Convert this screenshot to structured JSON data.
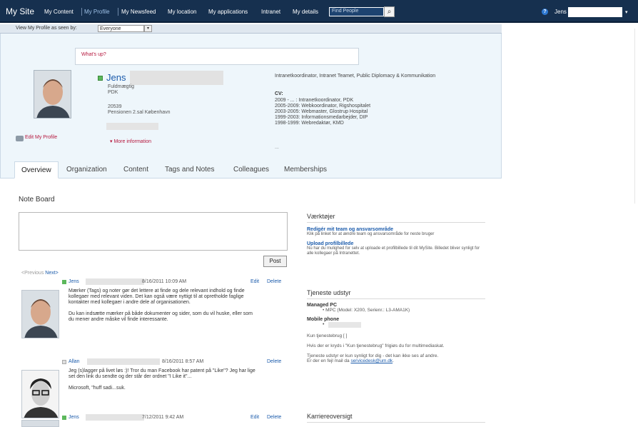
{
  "topbar": {
    "site_title": "My Site",
    "nav": [
      "My Content",
      "My Profile",
      "My Newsfeed",
      "My location",
      "My applications",
      "Intranet",
      "My details"
    ],
    "search_placeholder": "Find People",
    "user": "Jens"
  },
  "viewas": {
    "label": "View My Profile as seen by:",
    "value": "Everyone"
  },
  "profile": {
    "status_prompt": "What's up?",
    "name": "Jens",
    "edit_label": "Edit My Profile",
    "info": [
      "Fuldmægtig",
      "PDK",
      "",
      "20539",
      "Pensionen 2.sal København"
    ],
    "more_info": "▾ More information",
    "about": "Intranetkoordinator, Intranet Teamet, Public Diplomacy & Kommunikation",
    "cv_title": "CV:",
    "cv": [
      "2009 - ... : Intranetkoordinator, PDK",
      "2005-2009: Webkoordinator, Rigshospitalet",
      "2003-2005: Webmaster, Glostrup Hospital",
      "1999-2003: Informationsmedarbejder, DIP",
      "1998-1999: Webredaktør, KMD"
    ],
    "cv_more": "..."
  },
  "tabs": [
    "Overview",
    "Organization",
    "Content",
    "Tags and Notes",
    "Colleagues",
    "Memberships"
  ],
  "noteboard": {
    "title": "Note Board",
    "post": "Post",
    "prev": "<Previous",
    "next": "Next>",
    "notes": [
      {
        "author": "Jens",
        "date": "8/16/2011 10:09 AM",
        "edit": "Edit",
        "delete": "Delete",
        "p1": "Mærker (Tags) og noter gør det lettere at finde og dele relevant indhold og finde kollegaer med relevant viden. Det kan også være nyttigt til at opretholde faglige kontakter med kollegaer i andre dele af organisationen.",
        "p2": "Du kan indsætte mærker på både dokumenter og sider, som du vil huske, eller som du mener andre måske vil finde interessante."
      },
      {
        "author": "Allan",
        "date": "8/16/2011 8:57 AM",
        "delete": "Delete",
        "p1": "Jeg (s)lagger på livet løs :)! Tror du man Facebook har patent på \"Like\"? Jeg har lige set den link du sendte og der står der ordnet \"I Like it\"...",
        "p2": "Microsoft, \"huff sadi...suk."
      },
      {
        "author": "Jens",
        "date": "7/12/2011 9:42 AM",
        "edit": "Edit",
        "delete": "Delete"
      }
    ]
  },
  "tools": {
    "title": "Værktøjer",
    "link1": "Redigér mit team og ansvarsområde",
    "desc1": "Klik på linket for at ændre team og ansvarsområde for neste bruger",
    "link2": "Upload profilbillede",
    "desc2": "Nu har du mulighed for selv at uploade et profilbillede til dit MySite. Billedet bliver synligt for alle kollegaer på Intranettet."
  },
  "equipment": {
    "title": "Tjeneste udstyr",
    "pc_label": "Managed PC",
    "pc_item": "MPC (Model: X200, Serienr.: L3-AMA1K)",
    "mobile_label": "Mobile phone",
    "usage": "Kun tjenestebrug [ ]",
    "note1": "Hvis der er kryds i \"Kun tjenestebrug\" frigiøs du for multimediaskat.",
    "note2": "Tjeneste udstyr er kun synligt for dig - det kan ikke ses af andre.",
    "note3_prefix": "Er der en fejl mail da",
    "email": "servicedesk@um.dk",
    "note3_suffix": "."
  },
  "career": {
    "title": "Karriereoversigt"
  }
}
